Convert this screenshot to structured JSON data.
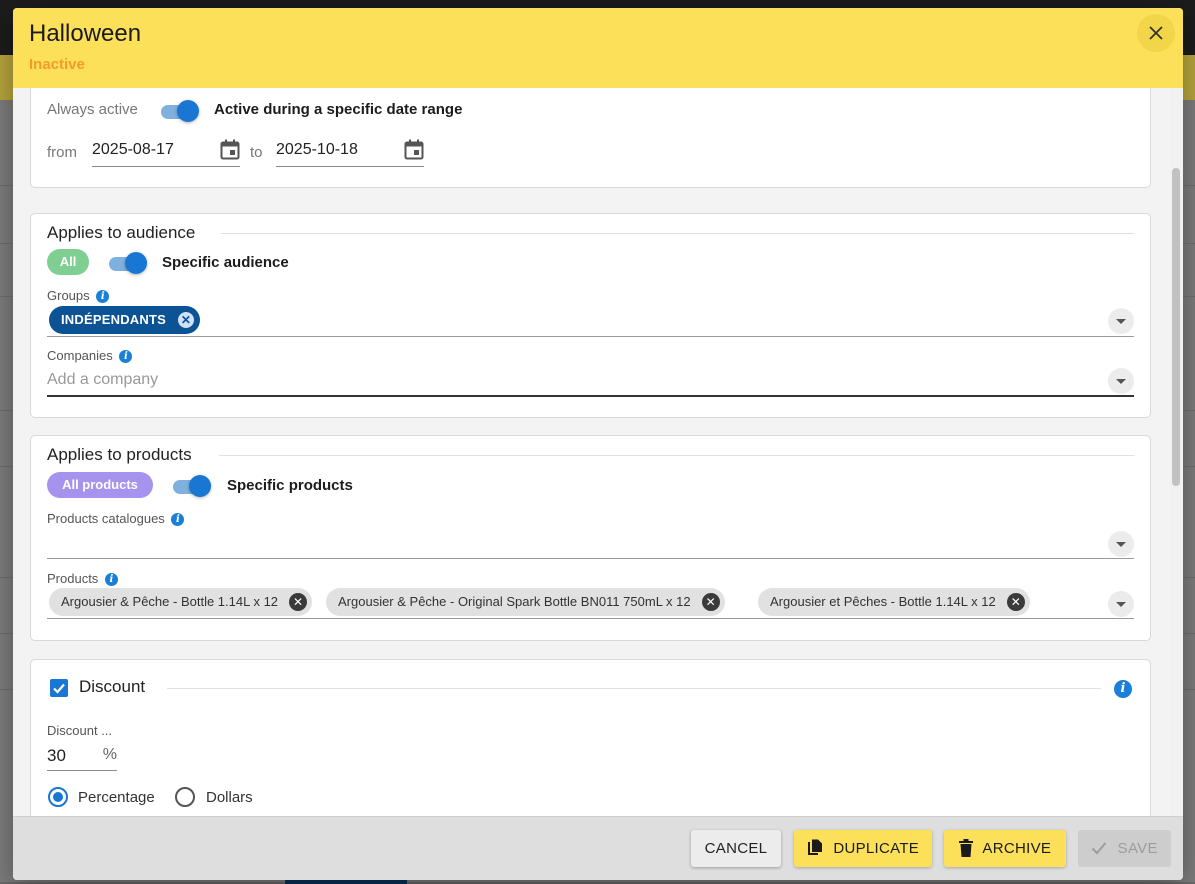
{
  "modal": {
    "title": "Halloween",
    "status": "Inactive"
  },
  "date_range": {
    "always_active_label": "Always active",
    "specific_range_label": "Active during a specific date range",
    "from_label": "from",
    "from_value": "2025-08-17",
    "to_label": "to",
    "to_value": "2025-10-18"
  },
  "audience": {
    "section_title": "Applies to audience",
    "all_label": "All",
    "specific_label": "Specific audience",
    "groups_label": "Groups",
    "groups_chips": [
      "INDÉPENDANTS"
    ],
    "companies_label": "Companies",
    "companies_placeholder": "Add a company"
  },
  "products": {
    "section_title": "Applies to products",
    "all_label": "All products",
    "specific_label": "Specific products",
    "catalogues_label": "Products catalogues",
    "products_label": "Products",
    "chips": [
      "Argousier & Pêche - Bottle 1.14L x 12",
      "Argousier & Pêche - Original Spark Bottle BN011 750mL x 12",
      "Argousier et Pêches - Bottle 1.14L x 12"
    ]
  },
  "discount": {
    "section_title": "Discount",
    "field_label": "Discount ...",
    "value": "30",
    "unit": "%",
    "percentage_label": "Percentage",
    "dollars_label": "Dollars"
  },
  "footer": {
    "cancel_label": "CANCEL",
    "duplicate_label": "DUPLICATE",
    "archive_label": "ARCHIVE",
    "save_label": "SAVE"
  },
  "colors": {
    "header_bg": "#fde05a",
    "status": "#f39a2c",
    "accent": "#1976d2",
    "chip_group": "#0b5394",
    "pill_audience": "#7fcf93",
    "pill_products": "#a593ee"
  }
}
